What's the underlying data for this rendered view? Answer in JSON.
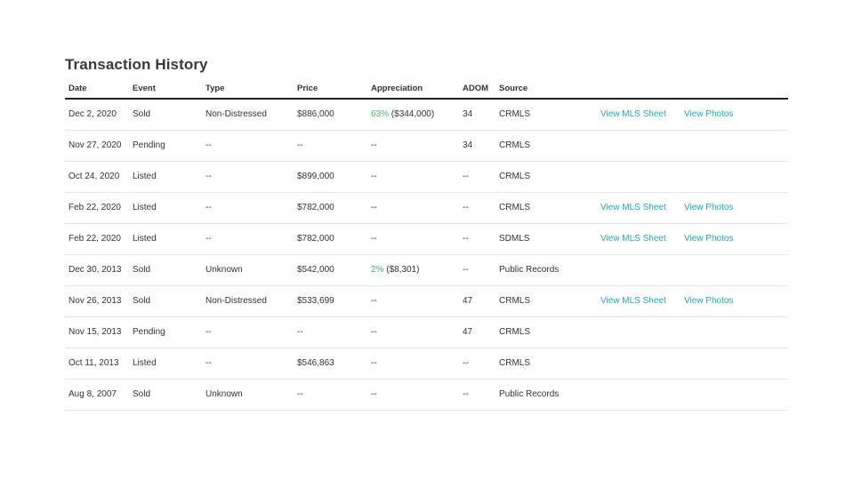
{
  "page": {
    "title": "Transaction History"
  },
  "columns": {
    "date": "Date",
    "event": "Event",
    "type": "Type",
    "price": "Price",
    "appreciation": "Appreciation",
    "adom": "ADOM",
    "source": "Source"
  },
  "colors": {
    "appreciation_pct": "#4caf6e",
    "link": "#1fa7bd"
  },
  "rows": [
    {
      "date": "Dec 2, 2020",
      "event": "Sold",
      "type": "Non-Distressed",
      "price": "$886,000",
      "appreciation_pct": "63%",
      "appreciation_amt": "($344,000)",
      "adom": "34",
      "source": "CRMLS",
      "mls_link": "View MLS Sheet",
      "photos_link": "View Photos"
    },
    {
      "date": "Nov 27, 2020",
      "event": "Pending",
      "type": "--",
      "price": "--",
      "appreciation_pct": "",
      "appreciation_amt": "--",
      "adom": "34",
      "source": "CRMLS",
      "mls_link": "",
      "photos_link": ""
    },
    {
      "date": "Oct 24, 2020",
      "event": "Listed",
      "type": "--",
      "price": "$899,000",
      "appreciation_pct": "",
      "appreciation_amt": "--",
      "adom": "--",
      "source": "CRMLS",
      "mls_link": "",
      "photos_link": ""
    },
    {
      "date": "Feb 22, 2020",
      "event": "Listed",
      "type": "--",
      "price": "$782,000",
      "appreciation_pct": "",
      "appreciation_amt": "--",
      "adom": "--",
      "source": "CRMLS",
      "mls_link": "View MLS Sheet",
      "photos_link": "View Photos"
    },
    {
      "date": "Feb 22, 2020",
      "event": "Listed",
      "type": "--",
      "price": "$782,000",
      "appreciation_pct": "",
      "appreciation_amt": "--",
      "adom": "--",
      "source": "SDMLS",
      "mls_link": "View MLS Sheet",
      "photos_link": "View Photos"
    },
    {
      "date": "Dec 30, 2013",
      "event": "Sold",
      "type": "Unknown",
      "price": "$542,000",
      "appreciation_pct": "2%",
      "appreciation_amt": "($8,301)",
      "adom": "--",
      "source": "Public Records",
      "mls_link": "",
      "photos_link": ""
    },
    {
      "date": "Nov 26, 2013",
      "event": "Sold",
      "type": "Non-Distressed",
      "price": "$533,699",
      "appreciation_pct": "",
      "appreciation_amt": "--",
      "adom": "47",
      "source": "CRMLS",
      "mls_link": "View MLS Sheet",
      "photos_link": "View Photos"
    },
    {
      "date": "Nov 15, 2013",
      "event": "Pending",
      "type": "--",
      "price": "--",
      "appreciation_pct": "",
      "appreciation_amt": "--",
      "adom": "47",
      "source": "CRMLS",
      "mls_link": "",
      "photos_link": ""
    },
    {
      "date": "Oct 11, 2013",
      "event": "Listed",
      "type": "--",
      "price": "$546,863",
      "appreciation_pct": "",
      "appreciation_amt": "--",
      "adom": "--",
      "source": "CRMLS",
      "mls_link": "",
      "photos_link": ""
    },
    {
      "date": "Aug 8, 2007",
      "event": "Sold",
      "type": "Unknown",
      "price": "--",
      "appreciation_pct": "",
      "appreciation_amt": "--",
      "adom": "--",
      "source": "Public Records",
      "mls_link": "",
      "photos_link": ""
    }
  ]
}
